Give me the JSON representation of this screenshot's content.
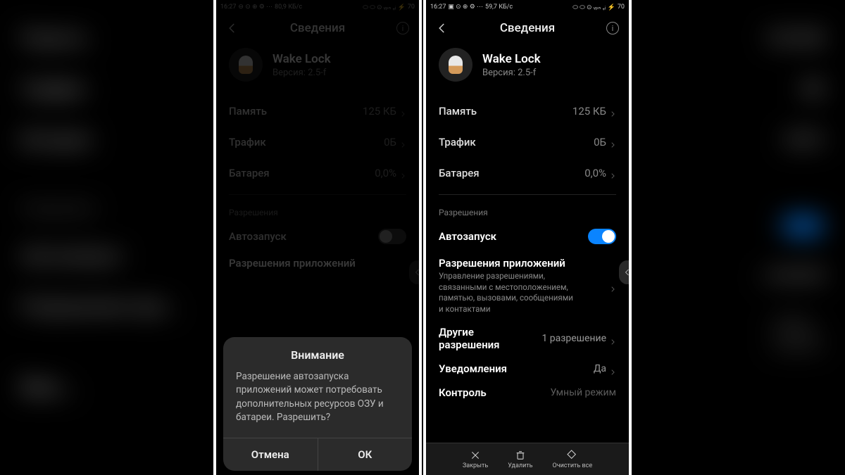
{
  "statusbar": {
    "time": "16:27",
    "speed_left": "80,9 КБ/с",
    "speed_right": "59,7 КБ/с",
    "battery": "70"
  },
  "header": {
    "title": "Сведения"
  },
  "app": {
    "name": "Wake Lock",
    "version": "Версия: 2.5-f"
  },
  "usage": {
    "memory_label": "Память",
    "memory_value": "125 КБ",
    "traffic_label": "Трафик",
    "traffic_value": "0Б",
    "battery_label": "Батарея",
    "battery_value": "0,0%"
  },
  "permissions": {
    "section": "Разрешения",
    "autostart": "Автозапуск",
    "app_perms_title": "Разрешения приложений",
    "app_perms_sub": "Управление разрешениями, связанными с местоположением, памятью, вызовами, сообщениями и контактами",
    "other_title": "Другие разрешения",
    "other_value": "1 разрешение",
    "notif_title": "Уведомления",
    "notif_value": "Да",
    "control_title": "Контроль",
    "control_value": "Умный режим"
  },
  "dialog": {
    "title": "Внимание",
    "body": "Разрешение автозапуска приложений может потребовать дополнительных ресурсов ОЗУ и батареи. Разрешить?",
    "cancel": "Отмена",
    "ok": "ОК"
  },
  "actionbar": {
    "close": "Закрыть",
    "delete": "Удалить",
    "clear": "Очистить все"
  }
}
